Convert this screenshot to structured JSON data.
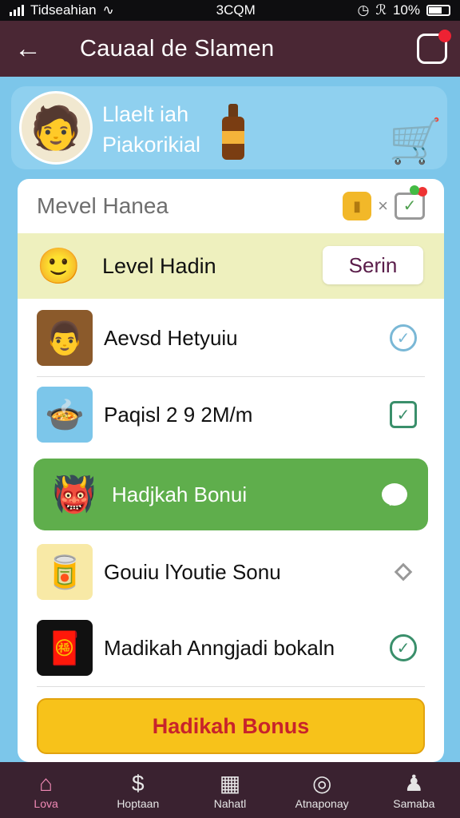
{
  "status_bar": {
    "carrier": "Tidseahian",
    "time": "3CQM",
    "battery": "10%"
  },
  "app_bar": {
    "title": "Cauaal de Slamen"
  },
  "banner": {
    "line1": "Llaelt iah",
    "line2": "Piakorikial"
  },
  "card": {
    "title": "Mevel Hanea",
    "level": {
      "label": "Level Hadin",
      "button": "Serin"
    },
    "items": [
      {
        "label": "Aevsd Hetyuiu",
        "action_icon": "check-circle-icon"
      },
      {
        "label": "Paqisl  2 9  2M/m",
        "action_icon": "home-check-icon"
      },
      {
        "label": "Hadjkah Bonui",
        "action_icon": "chat-bubble-icon"
      },
      {
        "label": "Gouiu lYoutie Sonu",
        "action_icon": "diamond-icon"
      },
      {
        "label": "Madikah Anngjadi bokaln",
        "action_icon": "check-circle-icon"
      }
    ],
    "cta": "Hadikah Bonus"
  },
  "bottom_nav": [
    {
      "label": "Lova",
      "icon": "home-icon",
      "active": true
    },
    {
      "label": "Hoptaan",
      "icon": "dollar-icon",
      "active": false
    },
    {
      "label": "Nahatl",
      "icon": "gift-icon",
      "active": false
    },
    {
      "label": "Atnaponay",
      "icon": "map-pin-icon",
      "active": false
    },
    {
      "label": "Samaba",
      "icon": "profile-icon",
      "active": false
    }
  ],
  "colors": {
    "app_bar": "#4a2734",
    "background": "#7cc6ea",
    "highlight": "#5fae4c",
    "cta": "#f7c21a",
    "cta_text": "#c8232b",
    "nav_active": "#f28ab6"
  }
}
